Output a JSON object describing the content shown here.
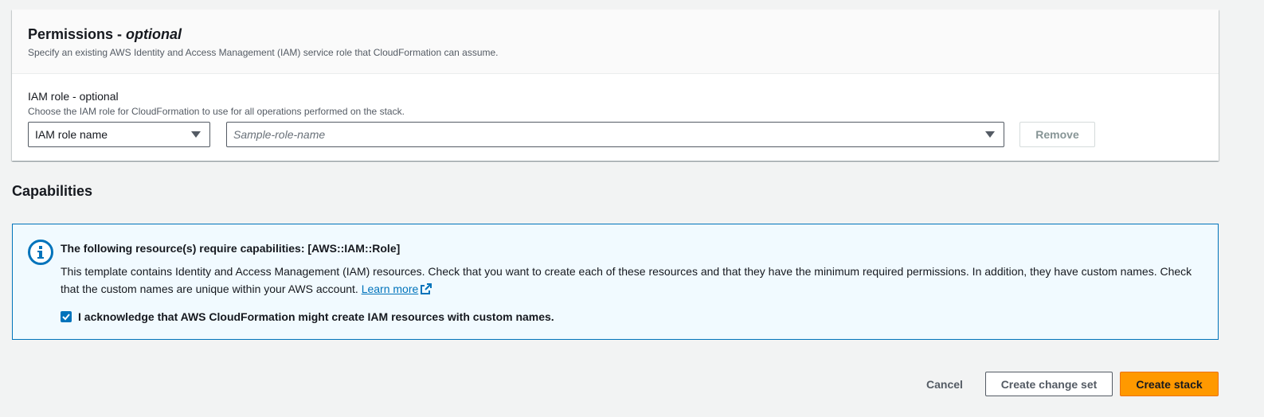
{
  "permissions": {
    "title": "Permissions - ",
    "title_optional": "optional",
    "description": "Specify an existing AWS Identity and Access Management (IAM) service role that CloudFormation can assume.",
    "iam_role": {
      "label": "IAM role - optional",
      "description": "Choose the IAM role for CloudFormation to use for all operations performed on the stack.",
      "type_select_value": "IAM role name",
      "role_select_placeholder": "Sample-role-name",
      "remove_label": "Remove"
    }
  },
  "capabilities": {
    "heading": "Capabilities",
    "alert_title": "The following resource(s) require capabilities: [AWS::IAM::Role]",
    "alert_text": "This template contains Identity and Access Management (IAM) resources. Check that you want to create each of these resources and that they have the minimum required permissions. In addition, they have custom names. Check that the custom names are unique within your AWS account.",
    "learn_more": "Learn more",
    "acknowledge_label": "I acknowledge that AWS CloudFormation might create IAM resources with custom names.",
    "acknowledge_checked": true
  },
  "footer": {
    "cancel_label": "Cancel",
    "change_set_label": "Create change set",
    "create_stack_label": "Create stack"
  },
  "colors": {
    "accent_blue": "#0073bb",
    "primary_orange": "#ff9900",
    "page_bg": "#f2f3f3",
    "info_bg": "#f1faff"
  },
  "icons": {
    "info": "info-icon",
    "external": "external-link-icon",
    "caret": "caret-down-icon",
    "check": "check-icon"
  }
}
